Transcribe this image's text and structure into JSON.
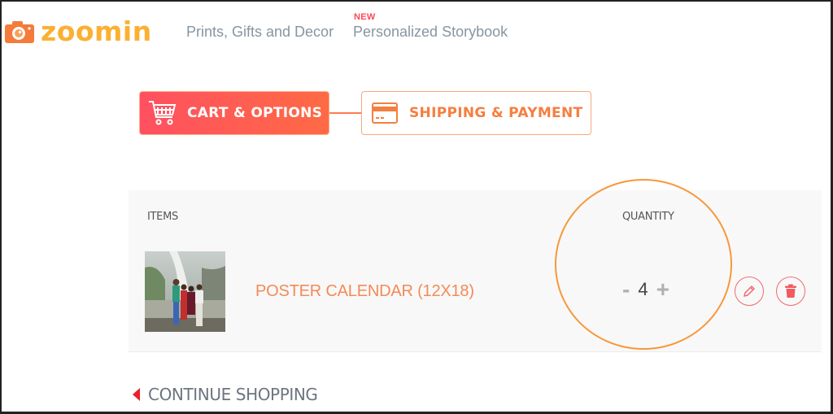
{
  "header": {
    "logo_text": "zoomin",
    "nav": [
      {
        "label": "Prints, Gifts and Decor"
      },
      {
        "label": "Personalized Storybook",
        "badge": "NEW"
      }
    ]
  },
  "checkout_steps": [
    {
      "label": "CART & OPTIONS",
      "icon": "cart-icon",
      "active": true
    },
    {
      "label": "SHIPPING & PAYMENT",
      "icon": "credit-card-icon",
      "active": false
    }
  ],
  "cart": {
    "columns": {
      "items": "ITEMS",
      "quantity": "QUANTITY"
    },
    "rows": [
      {
        "name": "POSTER CALENDAR (12X18)",
        "thumbnail": "group photo at waterfall",
        "quantity": "4",
        "decrement_label": "-",
        "increment_label": "+"
      }
    ]
  },
  "continue_shopping": "CONTINUE SHOPPING",
  "colors": {
    "brand_yellow": "#fbb033",
    "brand_orange": "#f47b3a",
    "active_step": "#ff5a52",
    "product_link": "#f48a56",
    "highlight_ring": "#f7983a",
    "delete_red": "#f06a72"
  }
}
